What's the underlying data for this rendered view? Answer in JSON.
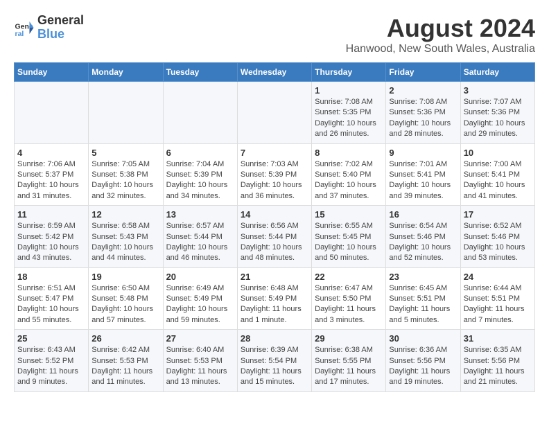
{
  "logo": {
    "line1": "General",
    "line2": "Blue"
  },
  "title": "August 2024",
  "subtitle": "Hanwood, New South Wales, Australia",
  "days_of_week": [
    "Sunday",
    "Monday",
    "Tuesday",
    "Wednesday",
    "Thursday",
    "Friday",
    "Saturday"
  ],
  "weeks": [
    [
      {
        "day": "",
        "info": ""
      },
      {
        "day": "",
        "info": ""
      },
      {
        "day": "",
        "info": ""
      },
      {
        "day": "",
        "info": ""
      },
      {
        "day": "1",
        "info": "Sunrise: 7:08 AM\nSunset: 5:35 PM\nDaylight: 10 hours\nand 26 minutes."
      },
      {
        "day": "2",
        "info": "Sunrise: 7:08 AM\nSunset: 5:36 PM\nDaylight: 10 hours\nand 28 minutes."
      },
      {
        "day": "3",
        "info": "Sunrise: 7:07 AM\nSunset: 5:36 PM\nDaylight: 10 hours\nand 29 minutes."
      }
    ],
    [
      {
        "day": "4",
        "info": "Sunrise: 7:06 AM\nSunset: 5:37 PM\nDaylight: 10 hours\nand 31 minutes."
      },
      {
        "day": "5",
        "info": "Sunrise: 7:05 AM\nSunset: 5:38 PM\nDaylight: 10 hours\nand 32 minutes."
      },
      {
        "day": "6",
        "info": "Sunrise: 7:04 AM\nSunset: 5:39 PM\nDaylight: 10 hours\nand 34 minutes."
      },
      {
        "day": "7",
        "info": "Sunrise: 7:03 AM\nSunset: 5:39 PM\nDaylight: 10 hours\nand 36 minutes."
      },
      {
        "day": "8",
        "info": "Sunrise: 7:02 AM\nSunset: 5:40 PM\nDaylight: 10 hours\nand 37 minutes."
      },
      {
        "day": "9",
        "info": "Sunrise: 7:01 AM\nSunset: 5:41 PM\nDaylight: 10 hours\nand 39 minutes."
      },
      {
        "day": "10",
        "info": "Sunrise: 7:00 AM\nSunset: 5:41 PM\nDaylight: 10 hours\nand 41 minutes."
      }
    ],
    [
      {
        "day": "11",
        "info": "Sunrise: 6:59 AM\nSunset: 5:42 PM\nDaylight: 10 hours\nand 43 minutes."
      },
      {
        "day": "12",
        "info": "Sunrise: 6:58 AM\nSunset: 5:43 PM\nDaylight: 10 hours\nand 44 minutes."
      },
      {
        "day": "13",
        "info": "Sunrise: 6:57 AM\nSunset: 5:44 PM\nDaylight: 10 hours\nand 46 minutes."
      },
      {
        "day": "14",
        "info": "Sunrise: 6:56 AM\nSunset: 5:44 PM\nDaylight: 10 hours\nand 48 minutes."
      },
      {
        "day": "15",
        "info": "Sunrise: 6:55 AM\nSunset: 5:45 PM\nDaylight: 10 hours\nand 50 minutes."
      },
      {
        "day": "16",
        "info": "Sunrise: 6:54 AM\nSunset: 5:46 PM\nDaylight: 10 hours\nand 52 minutes."
      },
      {
        "day": "17",
        "info": "Sunrise: 6:52 AM\nSunset: 5:46 PM\nDaylight: 10 hours\nand 53 minutes."
      }
    ],
    [
      {
        "day": "18",
        "info": "Sunrise: 6:51 AM\nSunset: 5:47 PM\nDaylight: 10 hours\nand 55 minutes."
      },
      {
        "day": "19",
        "info": "Sunrise: 6:50 AM\nSunset: 5:48 PM\nDaylight: 10 hours\nand 57 minutes."
      },
      {
        "day": "20",
        "info": "Sunrise: 6:49 AM\nSunset: 5:49 PM\nDaylight: 10 hours\nand 59 minutes."
      },
      {
        "day": "21",
        "info": "Sunrise: 6:48 AM\nSunset: 5:49 PM\nDaylight: 11 hours\nand 1 minute."
      },
      {
        "day": "22",
        "info": "Sunrise: 6:47 AM\nSunset: 5:50 PM\nDaylight: 11 hours\nand 3 minutes."
      },
      {
        "day": "23",
        "info": "Sunrise: 6:45 AM\nSunset: 5:51 PM\nDaylight: 11 hours\nand 5 minutes."
      },
      {
        "day": "24",
        "info": "Sunrise: 6:44 AM\nSunset: 5:51 PM\nDaylight: 11 hours\nand 7 minutes."
      }
    ],
    [
      {
        "day": "25",
        "info": "Sunrise: 6:43 AM\nSunset: 5:52 PM\nDaylight: 11 hours\nand 9 minutes."
      },
      {
        "day": "26",
        "info": "Sunrise: 6:42 AM\nSunset: 5:53 PM\nDaylight: 11 hours\nand 11 minutes."
      },
      {
        "day": "27",
        "info": "Sunrise: 6:40 AM\nSunset: 5:53 PM\nDaylight: 11 hours\nand 13 minutes."
      },
      {
        "day": "28",
        "info": "Sunrise: 6:39 AM\nSunset: 5:54 PM\nDaylight: 11 hours\nand 15 minutes."
      },
      {
        "day": "29",
        "info": "Sunrise: 6:38 AM\nSunset: 5:55 PM\nDaylight: 11 hours\nand 17 minutes."
      },
      {
        "day": "30",
        "info": "Sunrise: 6:36 AM\nSunset: 5:56 PM\nDaylight: 11 hours\nand 19 minutes."
      },
      {
        "day": "31",
        "info": "Sunrise: 6:35 AM\nSunset: 5:56 PM\nDaylight: 11 hours\nand 21 minutes."
      }
    ]
  ]
}
